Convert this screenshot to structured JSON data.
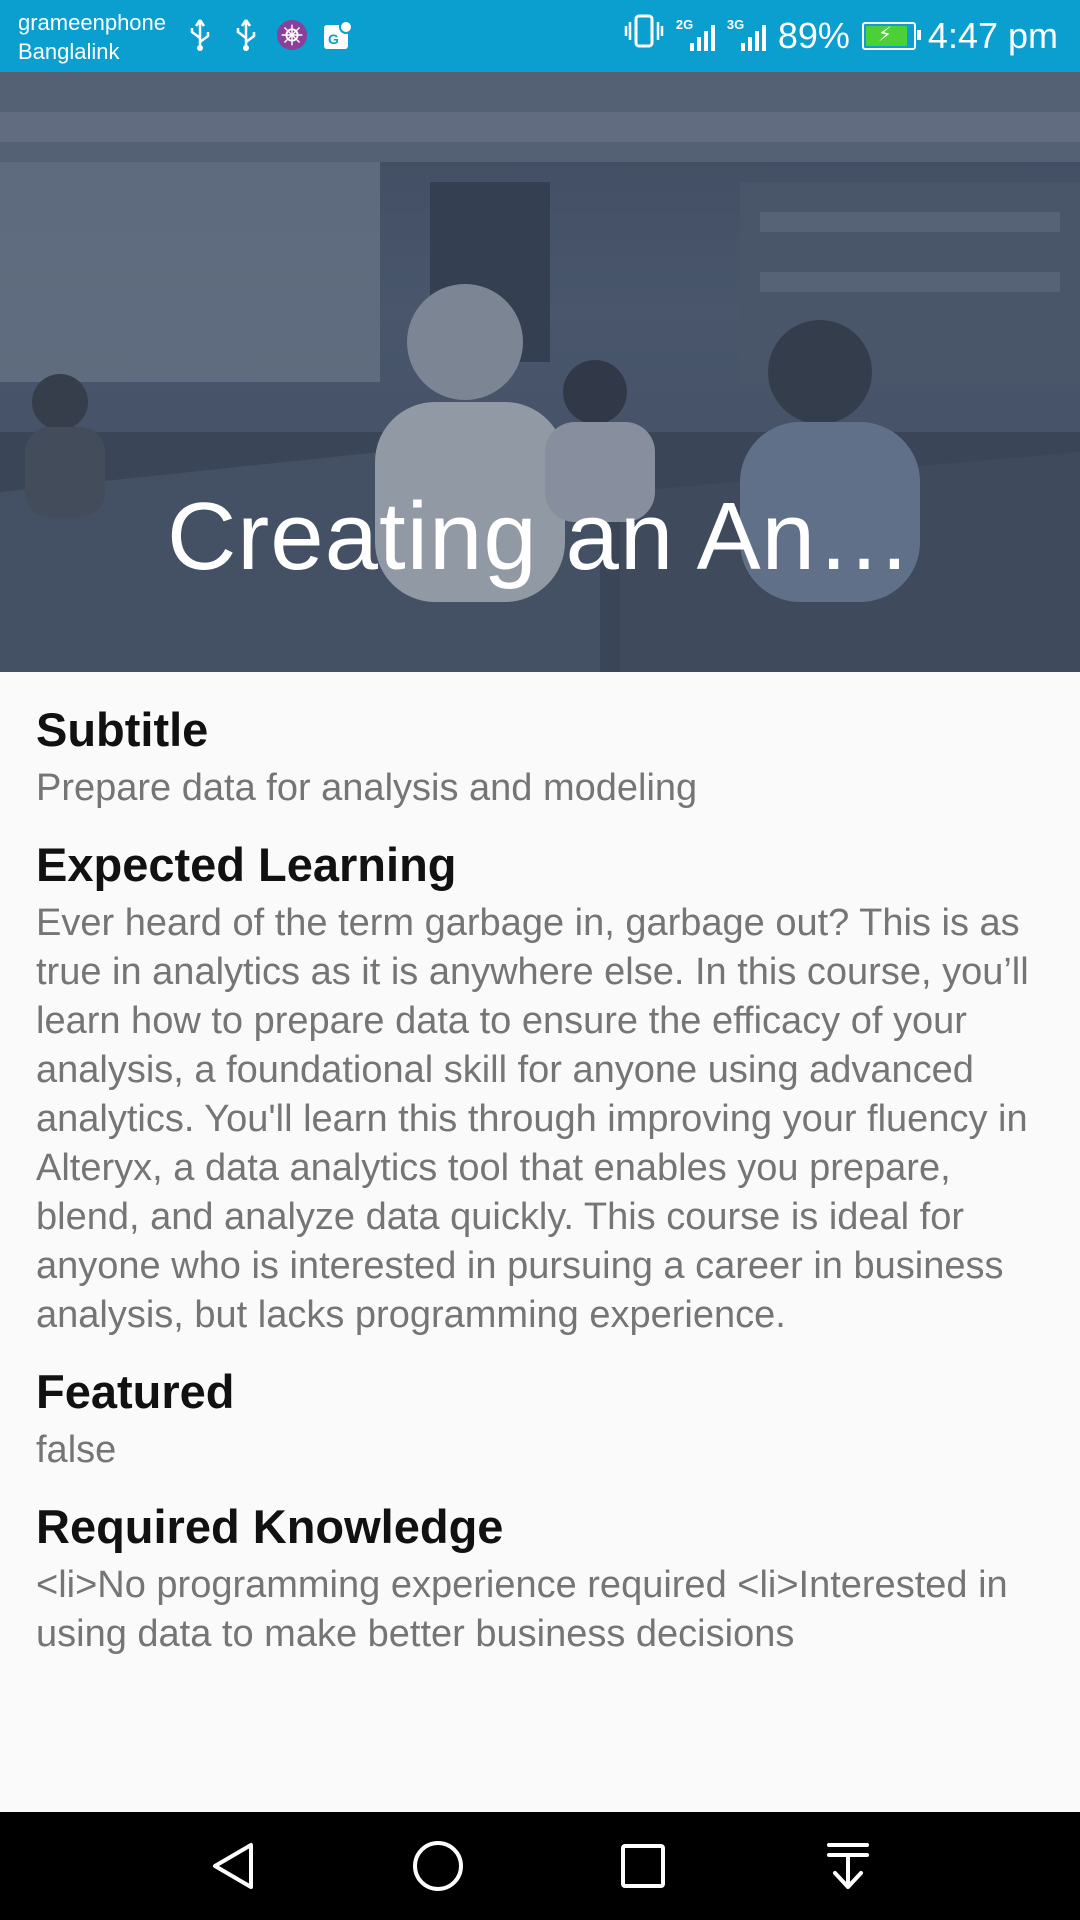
{
  "status_bar": {
    "carrier_1": "grameenphone",
    "carrier_2": "Banglalink",
    "network_1": "2G",
    "network_2": "3G",
    "battery_percent": "89%",
    "battery_level": 0.89,
    "time": "4:47 pm",
    "left_icons": [
      "usb-icon",
      "usb-icon",
      "app-badge-icon",
      "map-icon"
    ],
    "right_icons": [
      "vibrate-icon",
      "signal-icon",
      "signal-icon",
      "battery-charging-icon"
    ]
  },
  "header": {
    "title": "Creating an An…"
  },
  "details": {
    "subtitle_label": "Subtitle",
    "subtitle_value": "Prepare data for analysis and modeling",
    "expected_label": "Expected Learning",
    "expected_value": "Ever heard of the term garbage in, garbage out? This is as true in analytics as it is anywhere else. In this course, you’ll learn how to prepare data to ensure the efficacy of your analysis, a foundational skill for anyone using advanced analytics. You'll learn this through improving your fluency in Alteryx, a data analytics tool that enables you prepare, blend, and analyze data quickly. This course is ideal for anyone who is interested in pursuing a career in business analysis, but lacks programming experience.",
    "featured_label": "Featured",
    "featured_value": "false",
    "required_label": "Required Knowledge",
    "required_value": "<li>No programming experience required <li>Interested in using data to make better business decisions"
  },
  "nav_bar": {
    "icons": [
      "back-icon",
      "home-icon",
      "recents-icon",
      "notification-pull-icon"
    ]
  }
}
